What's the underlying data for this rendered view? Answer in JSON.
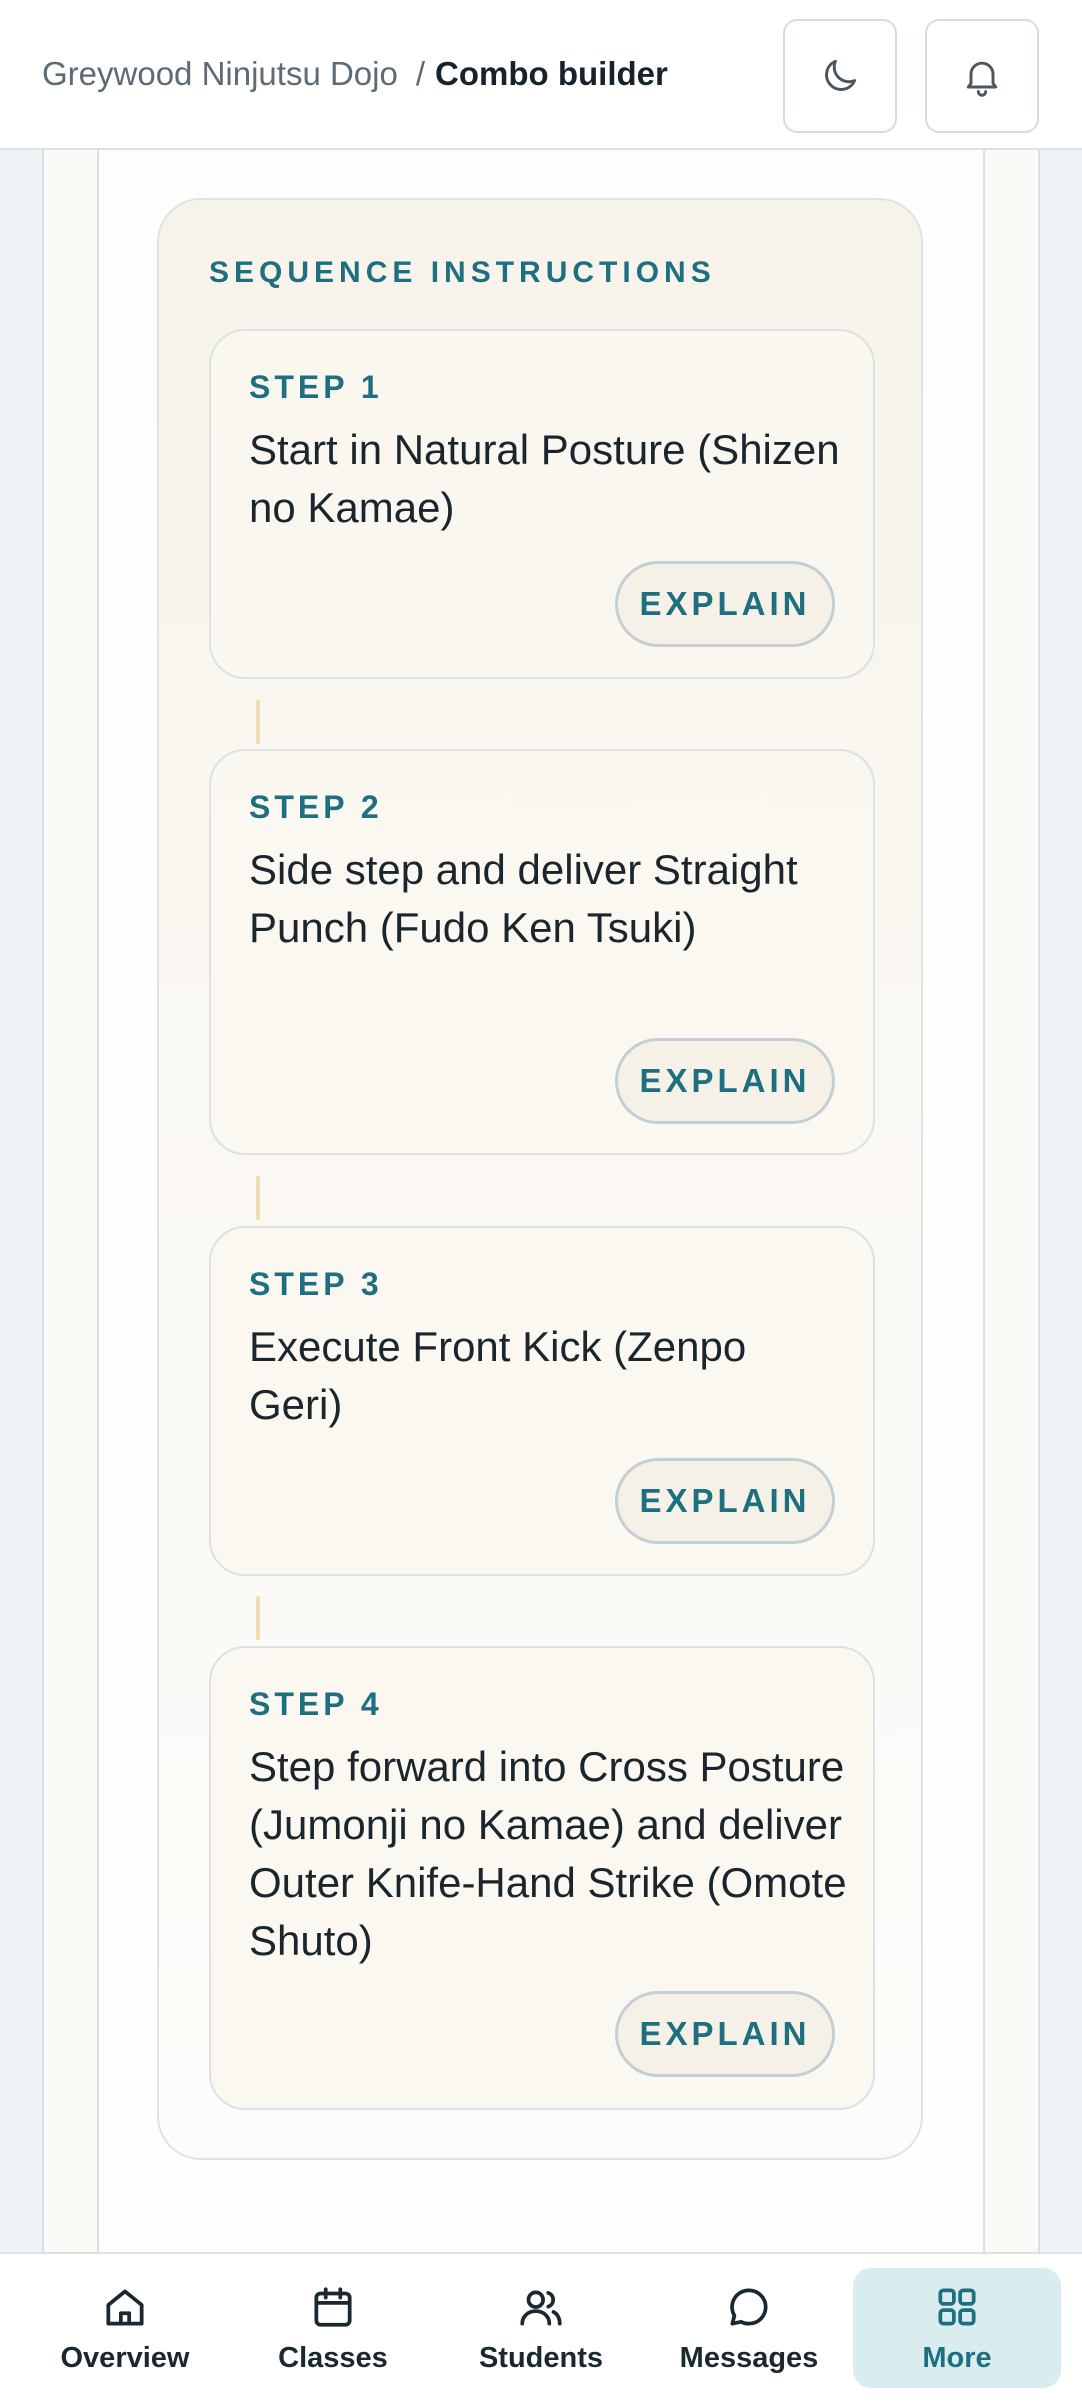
{
  "header": {
    "breadcrumb_parent": "Greywood Ninjutsu Dojo",
    "breadcrumb_separator": "/",
    "breadcrumb_current": "Combo builder",
    "theme_toggle_icon": "moon-icon",
    "notifications_icon": "bell-icon"
  },
  "sequence": {
    "title": "SEQUENCE INSTRUCTIONS",
    "steps": [
      {
        "label": "STEP 1",
        "text": "Start in Natural Posture (Shizen no Kamae)",
        "button": "EXPLAIN"
      },
      {
        "label": "STEP 2",
        "text": "Side step and deliver Straight Punch (Fudo Ken Tsuki)",
        "button": "EXPLAIN"
      },
      {
        "label": "STEP 3",
        "text": "Execute Front Kick (Zenpo Geri)",
        "button": "EXPLAIN"
      },
      {
        "label": "STEP 4",
        "text": "Step forward into Cross Posture (Jumonji no Kamae) and deliver Outer Knife-Hand Strike (Omote Shuto)",
        "button": "EXPLAIN"
      }
    ]
  },
  "nav": {
    "items": [
      {
        "label": "Overview",
        "icon": "home-icon"
      },
      {
        "label": "Classes",
        "icon": "calendar-icon"
      },
      {
        "label": "Students",
        "icon": "users-icon"
      },
      {
        "label": "Messages",
        "icon": "chat-icon"
      },
      {
        "label": "More",
        "icon": "grid-icon",
        "active": true
      }
    ]
  },
  "colors": {
    "accent": "#1e6f80",
    "active_nav_bg": "#d9edf1",
    "card_bg": "#f8f3ea"
  }
}
